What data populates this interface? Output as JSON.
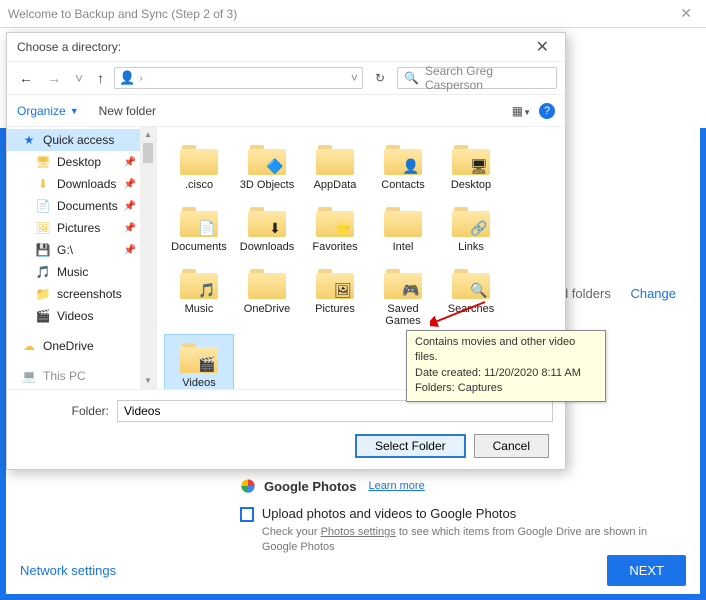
{
  "outer": {
    "title": "Welcome to Backup and Sync (Step 2 of 3)"
  },
  "bg": {
    "and_folders": "nd folders",
    "change": "Change",
    "gphotos_title": "Google Photos",
    "learn_more": "Learn more",
    "upload_label": "Upload photos and videos to Google Photos",
    "upload_sub_a": "Check your ",
    "upload_sub_u": "Photos settings",
    "upload_sub_b": " to see which items from Google Drive are shown in Google Photos",
    "network": "Network settings",
    "next": "NEXT"
  },
  "dialog": {
    "title": "Choose a directory:",
    "search_placeholder": "Search Greg Casperson",
    "organize": "Organize",
    "new_folder": "New folder",
    "folder_label": "Folder:",
    "folder_value": "Videos",
    "select_btn": "Select Folder",
    "cancel_btn": "Cancel"
  },
  "tree": [
    {
      "label": "Quick access",
      "kind": "star",
      "active": true,
      "pin": false
    },
    {
      "label": "Desktop",
      "kind": "desktop",
      "sub": true,
      "pin": true
    },
    {
      "label": "Downloads",
      "kind": "down",
      "sub": true,
      "pin": true
    },
    {
      "label": "Documents",
      "kind": "doc",
      "sub": true,
      "pin": true
    },
    {
      "label": "Pictures",
      "kind": "pic",
      "sub": true,
      "pin": true
    },
    {
      "label": "G:\\",
      "kind": "drive",
      "sub": true,
      "pin": true
    },
    {
      "label": "Music",
      "kind": "music",
      "sub": true,
      "pin": false
    },
    {
      "label": "screenshots",
      "kind": "folder",
      "sub": true,
      "pin": false
    },
    {
      "label": "Videos",
      "kind": "video",
      "sub": true,
      "pin": false
    },
    {
      "label": "OneDrive",
      "kind": "cloud",
      "sub": false,
      "pin": false,
      "gap": true
    },
    {
      "label": "This PC",
      "kind": "pc",
      "sub": false,
      "pin": false,
      "gap": true,
      "cut": true
    }
  ],
  "files": [
    {
      "label": ".cisco",
      "overlay": ""
    },
    {
      "label": "3D Objects",
      "overlay": "🔷"
    },
    {
      "label": "AppData",
      "overlay": ""
    },
    {
      "label": "Contacts",
      "overlay": "👤"
    },
    {
      "label": "Desktop",
      "overlay": "🖥"
    },
    {
      "label": "Documents",
      "overlay": "📄"
    },
    {
      "label": "Downloads",
      "overlay": "⬇"
    },
    {
      "label": "Favorites",
      "overlay": "⭐"
    },
    {
      "label": "Intel",
      "overlay": ""
    },
    {
      "label": "Links",
      "overlay": "🔗"
    },
    {
      "label": "Music",
      "overlay": "🎵"
    },
    {
      "label": "OneDrive",
      "overlay": ""
    },
    {
      "label": "Pictures",
      "overlay": "🖼"
    },
    {
      "label": "Saved Games",
      "overlay": "🎮"
    },
    {
      "label": "Searches",
      "overlay": "🔍"
    },
    {
      "label": "Videos",
      "overlay": "🎬",
      "selected": true
    }
  ],
  "tooltip": {
    "l1": "Contains movies and other video files.",
    "l2": "Date created: 11/20/2020 8:11 AM",
    "l3": "Folders: Captures"
  }
}
